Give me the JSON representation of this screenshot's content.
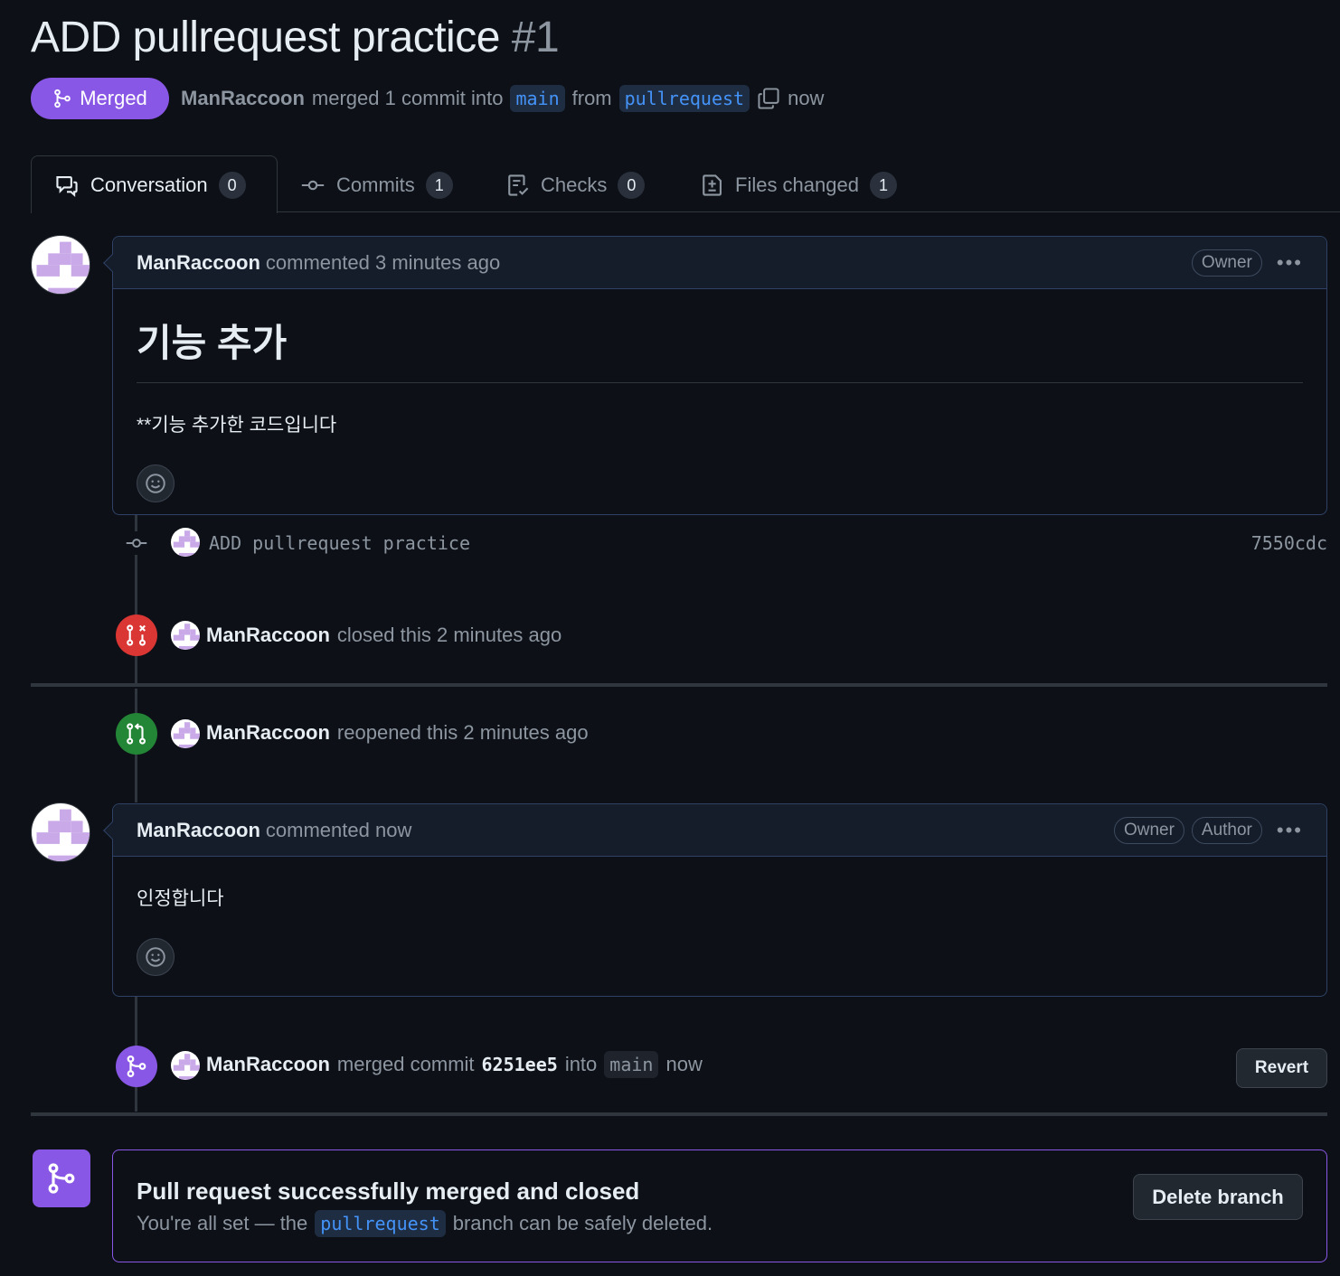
{
  "pr": {
    "title": "ADD pullrequest practice",
    "number": "#1",
    "status": "Merged",
    "author": "ManRaccoon",
    "summary_action": "merged 1 commit into",
    "base_branch": "main",
    "from_word": "from",
    "head_branch": "pullrequest",
    "time": "now"
  },
  "tabs": [
    {
      "label": "Conversation",
      "count": "0"
    },
    {
      "label": "Commits",
      "count": "1"
    },
    {
      "label": "Checks",
      "count": "0"
    },
    {
      "label": "Files changed",
      "count": "1"
    }
  ],
  "comment1": {
    "author": "ManRaccoon",
    "action": "commented 3 minutes ago",
    "role": "Owner",
    "heading": "기능 추가",
    "body": "**기능 추가한 코드입니다"
  },
  "commit_event": {
    "message": "ADD pullrequest practice",
    "sha": "7550cdc"
  },
  "closed_event": {
    "author": "ManRaccoon",
    "action": "closed this 2 minutes ago"
  },
  "reopened_event": {
    "author": "ManRaccoon",
    "action": "reopened this 2 minutes ago"
  },
  "comment2": {
    "author": "ManRaccoon",
    "action": "commented now",
    "roles": [
      "Owner",
      "Author"
    ],
    "body": "인정합니다"
  },
  "merged_event": {
    "author": "ManRaccoon",
    "action": "merged commit",
    "sha": "6251ee5",
    "into_word": "into",
    "branch": "main",
    "time": "now",
    "revert_label": "Revert"
  },
  "merge_box": {
    "title": "Pull request successfully merged and closed",
    "text_before": "You're all set — the",
    "branch": "pullrequest",
    "text_after": "branch can be safely deleted.",
    "delete_label": "Delete branch"
  },
  "colors": {
    "merged": "#8957e5",
    "closed": "#da3633",
    "reopened": "#238636",
    "link": "#4493f8"
  }
}
